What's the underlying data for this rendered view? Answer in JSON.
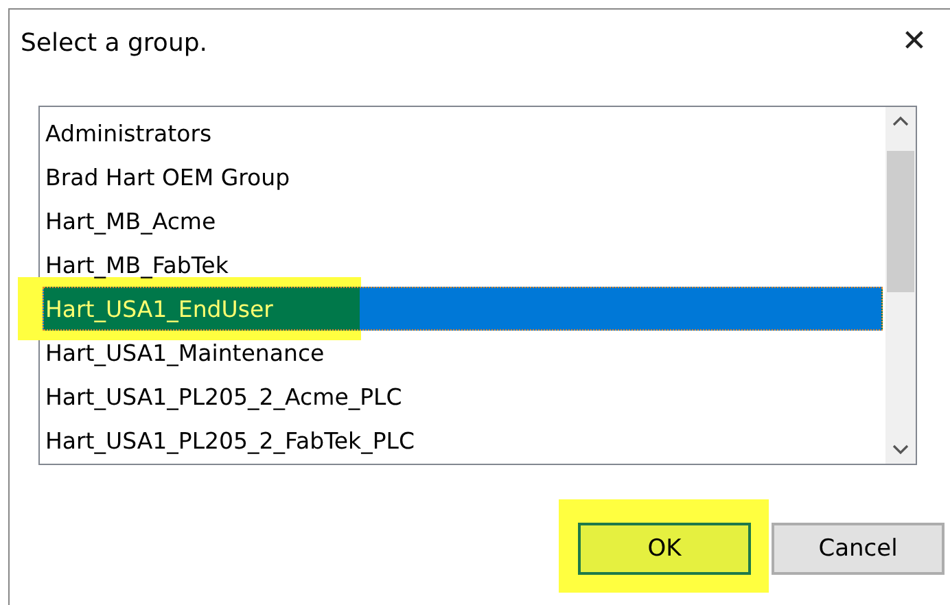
{
  "window": {
    "title": "Select a group.",
    "close": "✕"
  },
  "list": {
    "items": [
      {
        "label": "Administrators",
        "selected": false,
        "highlighted": false
      },
      {
        "label": "Brad Hart OEM Group",
        "selected": false,
        "highlighted": false
      },
      {
        "label": "Hart_MB_Acme",
        "selected": false,
        "highlighted": false
      },
      {
        "label": "Hart_MB_FabTek",
        "selected": false,
        "highlighted": false
      },
      {
        "label": "Hart_USA1_EndUser",
        "selected": true,
        "highlighted": true
      },
      {
        "label": "Hart_USA1_Maintenance",
        "selected": false,
        "highlighted": false
      },
      {
        "label": "Hart_USA1_PL205_2_Acme_PLC",
        "selected": false,
        "highlighted": false
      },
      {
        "label": "Hart_USA1_PL205_2_FabTek_PLC",
        "selected": false,
        "highlighted": false
      }
    ]
  },
  "buttons": [
    {
      "label": "OK",
      "default": true,
      "highlighted": true
    },
    {
      "label": "Cancel",
      "default": false,
      "highlighted": false
    }
  ]
}
